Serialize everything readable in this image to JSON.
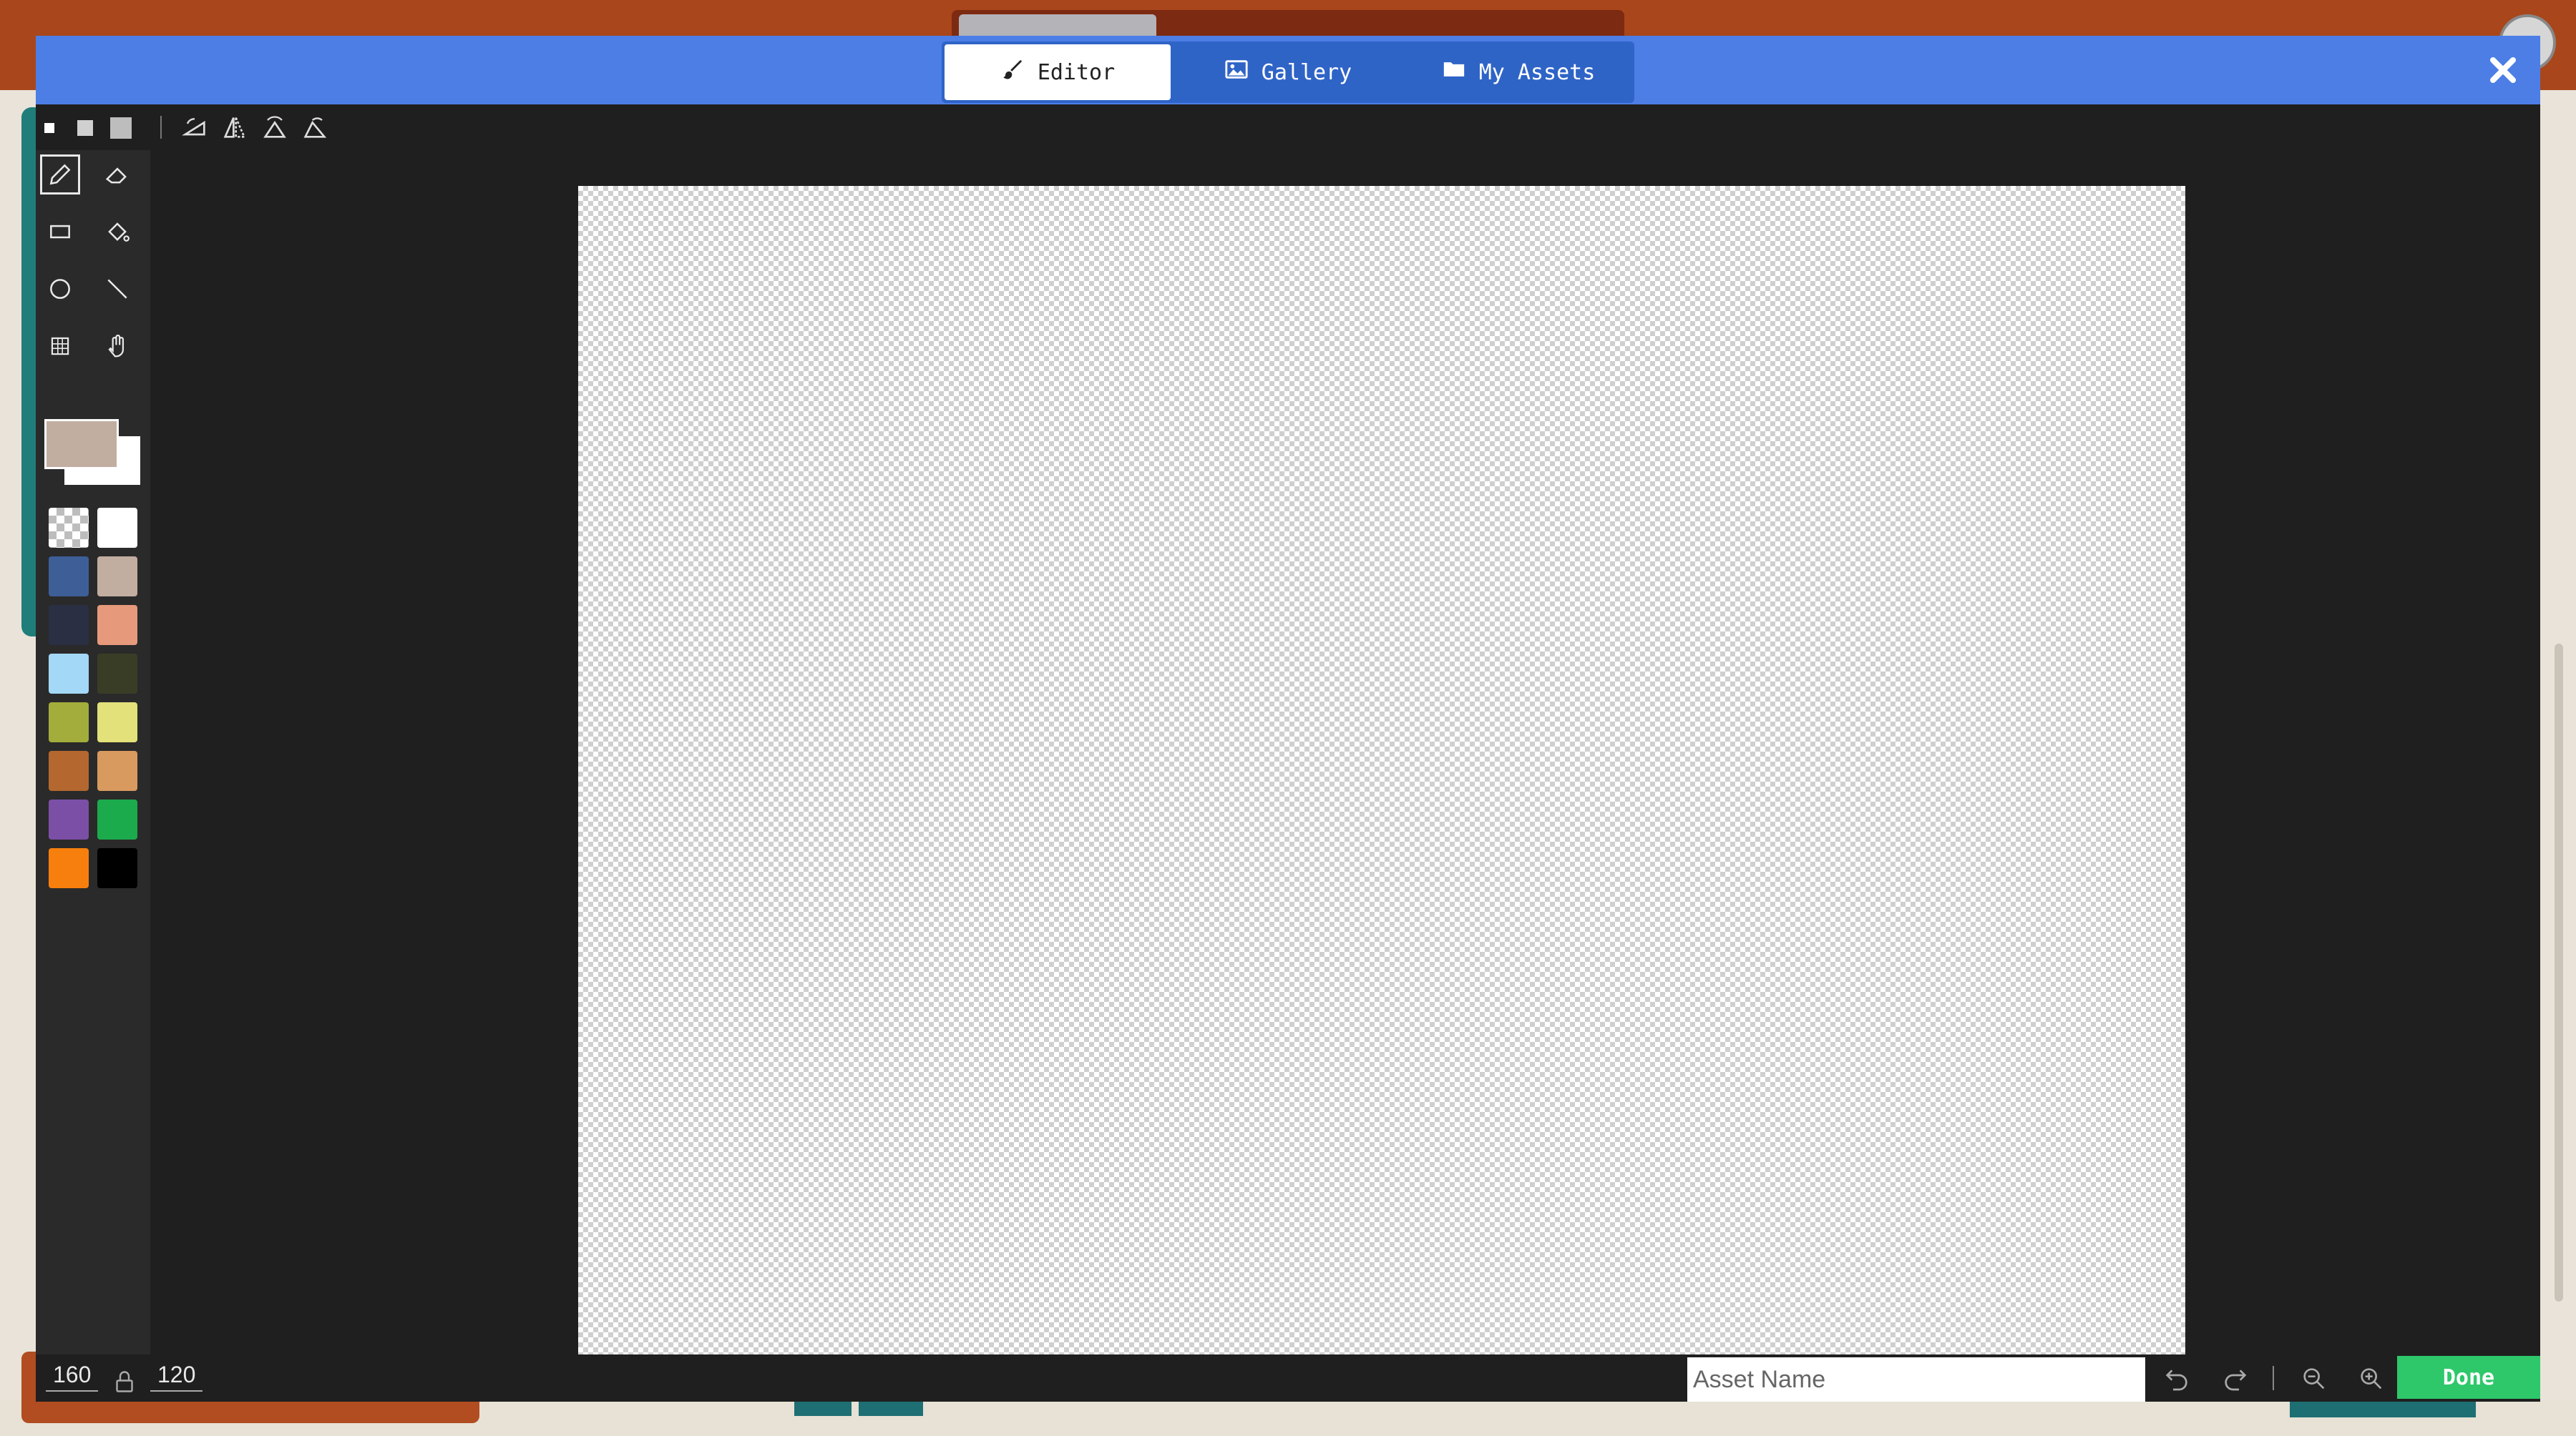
{
  "header": {
    "tabs": [
      {
        "label": "Editor",
        "icon": "paintbrush-icon",
        "active": true
      },
      {
        "label": "Gallery",
        "icon": "image-icon",
        "active": false
      },
      {
        "label": "My Assets",
        "icon": "folder-icon",
        "active": false
      }
    ],
    "close_icon": "close-icon"
  },
  "toolbar": {
    "brush_sizes": [
      "small",
      "medium",
      "large"
    ],
    "transforms": [
      "rotate-icon",
      "flip-horizontal-icon",
      "flip-vertical-icon",
      "rotate-alt-icon"
    ]
  },
  "tools": [
    "pencil",
    "eraser",
    "rectangle",
    "fill-bucket",
    "ellipse",
    "line",
    "grid-select",
    "hand"
  ],
  "colors": {
    "primary": "#c2ada1",
    "secondary": "#ffffff",
    "swatches": [
      "transparent",
      "#ffffff",
      "#3d5e97",
      "#c2ada1",
      "#2b2f44",
      "#e7997c",
      "#a3d8f6",
      "#3a3d26",
      "#a3ad3b",
      "#e2e17a",
      "#b4682f",
      "#d99a5f",
      "#7c4fa6",
      "#1bab4c",
      "#f77f0d",
      "#000000"
    ]
  },
  "bottom": {
    "width": "160",
    "height": "120",
    "asset_name_placeholder": "Asset Name",
    "done_label": "Done"
  }
}
